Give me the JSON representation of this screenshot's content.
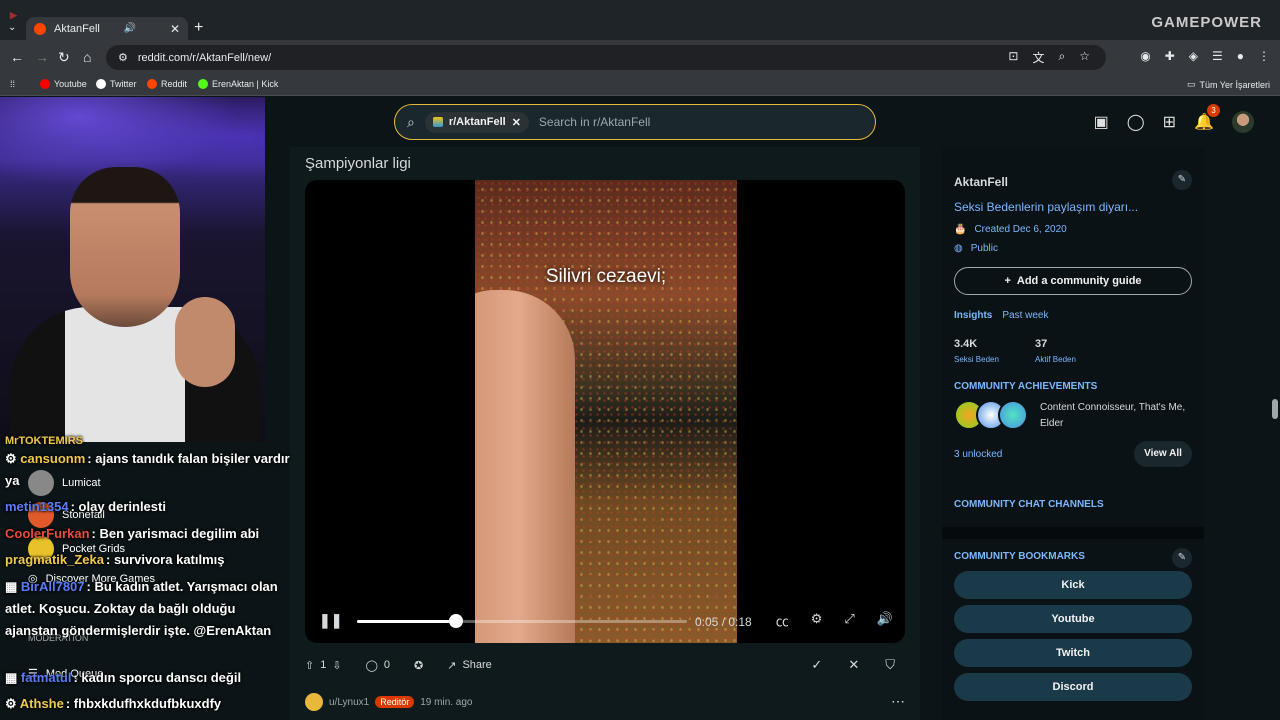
{
  "browser": {
    "tab_title": "AktanFell",
    "url": "reddit.com/r/AktanFell/new/",
    "bookmarks": [
      {
        "label": "Youtube",
        "color": "#ff0000"
      },
      {
        "label": "Twitter",
        "color": "#ffffff"
      },
      {
        "label": "Reddit",
        "color": "#ff4500"
      },
      {
        "label": "ErenAktan | Kick",
        "color": "#53fc18"
      }
    ],
    "all_bookmarks": "Tüm Yer İşaretleri",
    "brand_overlay": "GAMEPOWER"
  },
  "reddit": {
    "search_chip": "r/AktanFell",
    "search_placeholder": "Search in r/AktanFell",
    "notif_count": "3",
    "post": {
      "title": "Şampiyonlar ligi",
      "caption": "Silivri cezaevi;",
      "time": "0:05 / 0:18",
      "progress": 0.3,
      "votes": "1",
      "comments": "0",
      "share": "Share"
    },
    "next_post": {
      "user": "u/Lynux1",
      "flair": "Reditör",
      "age": "19 min. ago"
    },
    "sidebar": {
      "name": "AktanFell",
      "description": "Seksi Bedenlerin paylaşım diyarı...",
      "created": "Created Dec 6, 2020",
      "visibility": "Public",
      "guide_button": "Add a community guide",
      "insights_label": "Insights",
      "insights_period": "Past week",
      "stats": [
        {
          "value": "3.4K",
          "label": "Seksi Beden"
        },
        {
          "value": "37",
          "label": "Aktif Beden"
        }
      ],
      "achievements_heading": "COMMUNITY ACHIEVEMENTS",
      "achievements_text": "Content Connoisseur, That's Me, Elder",
      "unlocked": "3 unlocked",
      "view_all": "View All",
      "chat_heading": "COMMUNITY CHAT CHANNELS",
      "bookmarks_heading": "COMMUNITY BOOKMARKS",
      "bookmark_buttons": [
        "Kick",
        "Youtube",
        "Twitch",
        "Discord"
      ]
    }
  },
  "stream_chat": [
    {
      "user": "MrTOKTEMIRS",
      "text": "",
      "color": "#f2c94c"
    },
    {
      "user": "cansuonm",
      "text": ": ajans tanıdık falan bişiler vardır ya",
      "color": "#f2c94c"
    },
    {
      "user": "metin1354",
      "text": ": olay derinlesti",
      "color": "#5b7cfa"
    },
    {
      "user": "CoolerFurkan",
      "text": ": Ben yarismaci degilim abi",
      "color": "#e74c3c"
    },
    {
      "user": "pragmatik_Zeka",
      "text": ": survivora katılmış",
      "color": "#f2c94c"
    },
    {
      "user": "BirAll7807",
      "text": ": Bu kadın atlet. Yarışmacı olan atlet. Koşucu. Zoktay da bağlı olduğu ajanstan göndermişlerdir işte. @ErenAktan",
      "color": "#5b7cfa"
    },
    {
      "user": "fatmatul",
      "text": ": kadın sporcu danscı değil",
      "color": "#5b7cfa"
    },
    {
      "user": "Athshe",
      "text": ": fhbxkdufhxkdufbkuxdfy",
      "color": "#f2c94c"
    }
  ],
  "overlay_menu": [
    {
      "label": "Lumicat",
      "color": "#888888"
    },
    {
      "label": "Stonefall",
      "color": "#e25a2a"
    },
    {
      "label": "Pocket Grids",
      "color": "#e8c22a"
    },
    {
      "label": "Discover More Games",
      "color": "#444444"
    },
    {
      "label": "MODERATION",
      "color": ""
    },
    {
      "label": "Mod Queue",
      "color": ""
    }
  ]
}
